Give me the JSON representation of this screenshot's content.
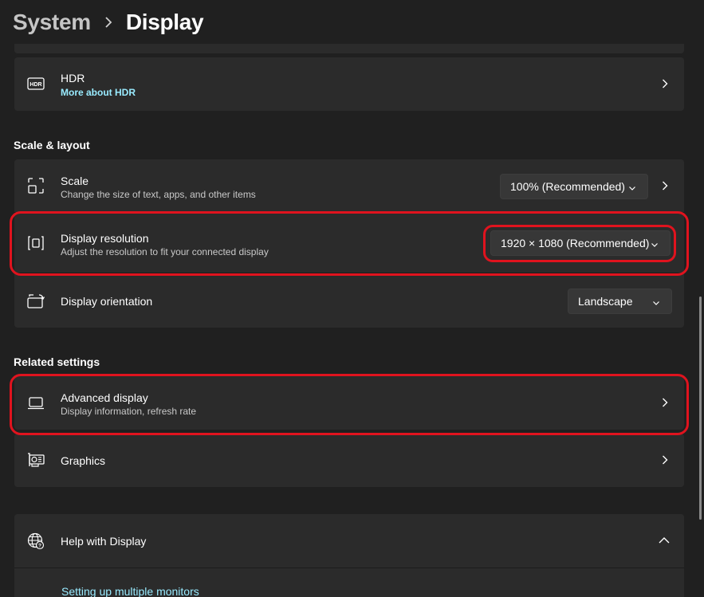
{
  "header": {
    "parent": "System",
    "current": "Display"
  },
  "hdr": {
    "title": "HDR",
    "link": "More about HDR"
  },
  "scale_layout": {
    "section_label": "Scale & layout",
    "scale": {
      "title": "Scale",
      "subtitle": "Change the size of text, apps, and other items",
      "value": "100% (Recommended)"
    },
    "resolution": {
      "title": "Display resolution",
      "subtitle": "Adjust the resolution to fit your connected display",
      "value": "1920 × 1080 (Recommended)"
    },
    "orientation": {
      "title": "Display orientation",
      "value": "Landscape"
    }
  },
  "related": {
    "section_label": "Related settings",
    "advanced": {
      "title": "Advanced display",
      "subtitle": "Display information, refresh rate"
    },
    "graphics": {
      "title": "Graphics"
    }
  },
  "help": {
    "title": "Help with Display",
    "link": "Setting up multiple monitors"
  },
  "colors": {
    "background": "#202020",
    "card": "#2b2b2b",
    "accent_link": "#99ebff",
    "annotation": "#e0131e"
  },
  "icons": {
    "breadcrumb_separator": "chevron-right-icon",
    "hdr": "hdr-icon",
    "scale": "scale-icon",
    "resolution": "resolution-icon",
    "orientation": "orientation-icon",
    "advanced": "laptop-icon",
    "graphics": "graphics-card-icon",
    "help": "globe-help-icon"
  }
}
